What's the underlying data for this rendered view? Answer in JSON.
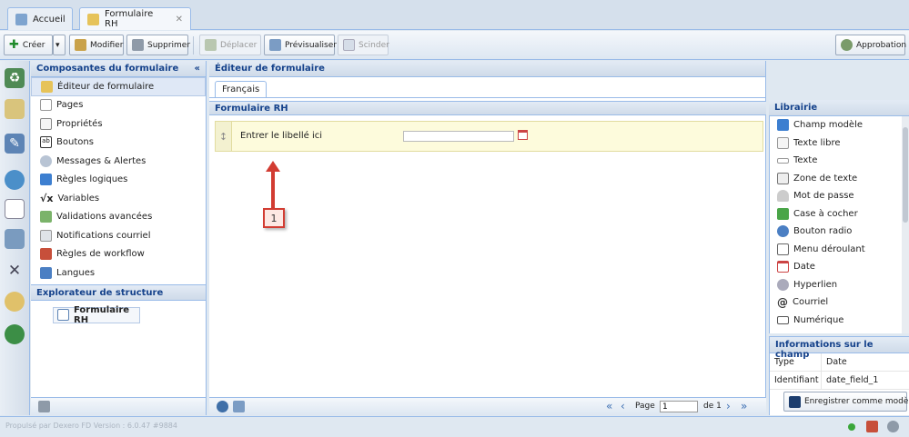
{
  "tabs": [
    {
      "label": "Accueil",
      "icon": "home-icon",
      "active": false
    },
    {
      "label": "Formulaire RH",
      "icon": "form-icon",
      "active": true
    }
  ],
  "toolbar": {
    "create": "Créer",
    "modify": "Modifier",
    "delete": "Supprimer",
    "move": "Déplacer",
    "preview": "Prévisualiser",
    "split": "Scinder",
    "approval": "Approbation"
  },
  "components": {
    "title": "Composantes du formulaire",
    "collapse": "«",
    "items": [
      {
        "label": "Éditeur de formulaire",
        "icon": "form-editor-icon",
        "selected": true
      },
      {
        "label": "Pages",
        "icon": "page-icon"
      },
      {
        "label": "Propriétés",
        "icon": "properties-icon"
      },
      {
        "label": "Boutons",
        "icon": "buttons-icon"
      },
      {
        "label": "Messages & Alertes",
        "icon": "message-icon"
      },
      {
        "label": "Règles logiques",
        "icon": "rules-icon"
      },
      {
        "label": "Variables",
        "icon": "variables-icon"
      },
      {
        "label": "Validations avancées",
        "icon": "validation-icon"
      },
      {
        "label": "Notifications courriel",
        "icon": "email-icon"
      },
      {
        "label": "Règles de workflow",
        "icon": "workflow-icon"
      },
      {
        "label": "Langues",
        "icon": "language-icon"
      }
    ]
  },
  "explorer": {
    "title": "Explorateur de structure",
    "root": "Formulaire RH"
  },
  "editor": {
    "title": "Éditeur de formulaire",
    "lang_tab": "Français",
    "form_title": "Formulaire RH",
    "field_label": "Entrer le libellé ici",
    "callout": "1"
  },
  "pager": {
    "page_label": "Page",
    "page_value": "1",
    "of_label": "de 1"
  },
  "library": {
    "title": "Librairie",
    "items": [
      {
        "label": "Champ modèle",
        "icon": "model-field-icon"
      },
      {
        "label": "Texte libre",
        "icon": "free-text-icon"
      },
      {
        "label": "Texte",
        "icon": "text-icon"
      },
      {
        "label": "Zone de texte",
        "icon": "textarea-icon"
      },
      {
        "label": "Mot de passe",
        "icon": "password-icon"
      },
      {
        "label": "Case à cocher",
        "icon": "checkbox-icon"
      },
      {
        "label": "Bouton radio",
        "icon": "radio-icon"
      },
      {
        "label": "Menu déroulant",
        "icon": "dropdown-icon"
      },
      {
        "label": "Date",
        "icon": "calendar-icon"
      },
      {
        "label": "Hyperlien",
        "icon": "link-icon"
      },
      {
        "label": "Courriel",
        "icon": "at-icon"
      },
      {
        "label": "Numérique",
        "icon": "numeric-icon"
      }
    ]
  },
  "field_info": {
    "title": "Informations sur le champ",
    "rows": [
      {
        "key": "Type",
        "value": "Date"
      },
      {
        "key": "Identifiant",
        "value": "date_field_1"
      }
    ],
    "save_model": "Enregistrer comme modèle"
  },
  "status": {
    "text": "Propulsé par Dexero FD Version : 6.0.47 #9884"
  },
  "colors": {
    "accent": "#15428b",
    "border": "#99bbe8",
    "callout_red": "#d23c32",
    "field_bg": "#fdfbdc"
  }
}
